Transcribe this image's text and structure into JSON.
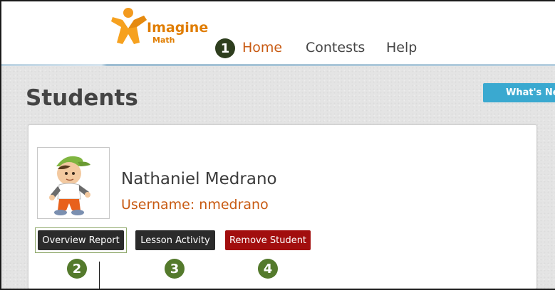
{
  "header": {
    "logo": {
      "title": "Imagine",
      "subtitle": "Math"
    },
    "nav": [
      {
        "label": "Home",
        "active": true,
        "callout": "1"
      },
      {
        "label": "Contests",
        "active": false
      },
      {
        "label": "Help",
        "active": false
      }
    ]
  },
  "page": {
    "title": "Students",
    "whats_new_label": "What's New"
  },
  "student": {
    "name": "Nathaniel Medrano",
    "username_line": "Username: nmedrano"
  },
  "actions": [
    {
      "label": "Overview Report",
      "callout": "2"
    },
    {
      "label": "Lesson Activity",
      "callout": "3"
    },
    {
      "label": "Remove Student",
      "callout": "4"
    }
  ],
  "colors": {
    "accent_orange": "#c85a12",
    "brand_orange": "#e07d00",
    "button_dark": "#2b2b2b",
    "button_danger": "#a20e0e",
    "whats_new_blue": "#3aa9d0",
    "callout_green": "#547a2c",
    "callout_dark": "#2e3e1e"
  },
  "icons": {
    "logo": "imagine-math-logo-icon",
    "avatar": "student-avatar-icon"
  }
}
